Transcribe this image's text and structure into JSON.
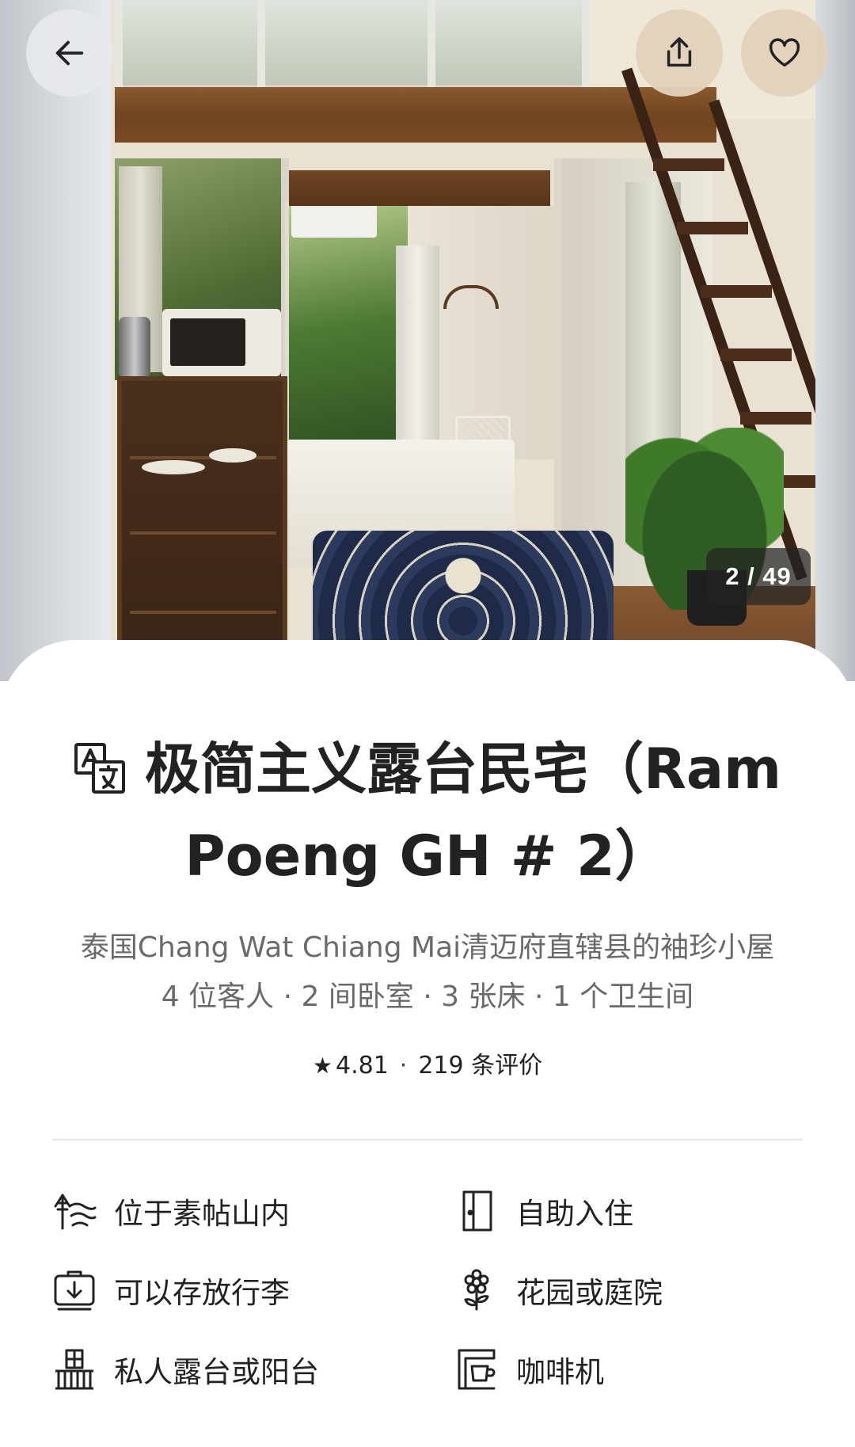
{
  "gallery": {
    "counter": "2 / 49"
  },
  "header_actions": {
    "back_icon": "back-arrow-icon",
    "share_icon": "share-icon",
    "favorite_icon": "heart-icon"
  },
  "listing": {
    "translate_icon": "translate-icon",
    "title": "极简主义露台民宅（Ram Poeng GH # 2）",
    "subtitle_line1": "泰国Chang Wat Chiang Mai清迈府直辖县的袖珍小屋",
    "subtitle_line2": "4 位客人 · 2 间卧室 · 3 张床 · 1 个卫生间",
    "rating": {
      "star_icon": "star-icon",
      "score": "4.81",
      "separator": "·",
      "reviews": "219 条评价"
    }
  },
  "features": [
    {
      "icon": "mountain-icon",
      "label": "位于素帖山内"
    },
    {
      "icon": "door-icon",
      "label": "自助入住"
    },
    {
      "icon": "luggage-storage-icon",
      "label": "可以存放行李"
    },
    {
      "icon": "flower-icon",
      "label": "花园或庭院"
    },
    {
      "icon": "balcony-icon",
      "label": "私人露台或阳台"
    },
    {
      "icon": "coffee-maker-icon",
      "label": "咖啡机"
    }
  ],
  "colors": {
    "text_primary": "#222222",
    "text_secondary": "#6a6a6a",
    "divider": "#e6e6e6",
    "counter_bg": "#222222"
  }
}
